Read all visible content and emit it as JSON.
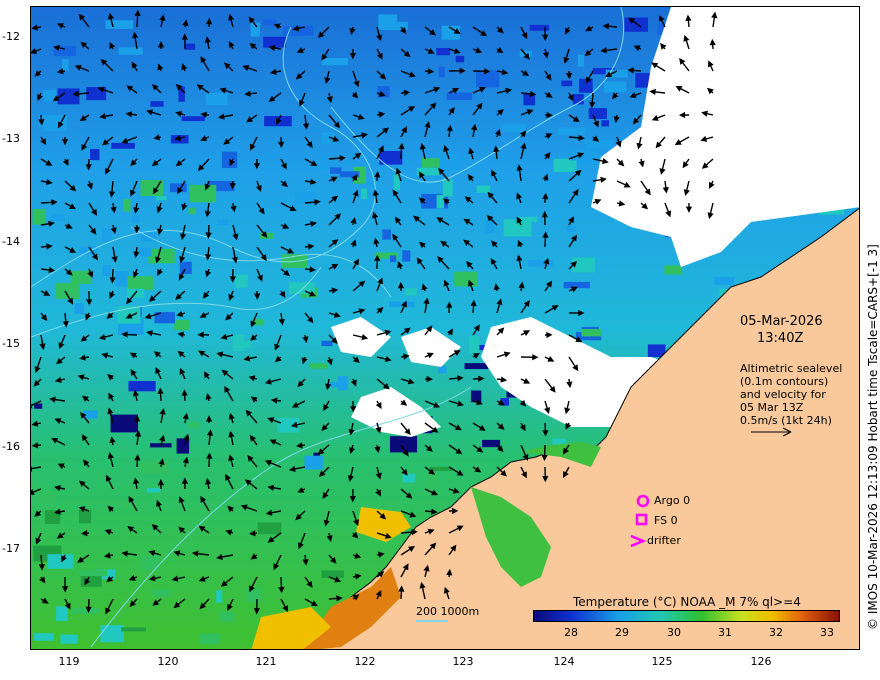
{
  "map": {
    "y_axis_labels": [
      "-12",
      "-13",
      "-14",
      "-15",
      "-16",
      "-17"
    ],
    "x_axis_labels": [
      "119",
      "120",
      "121",
      "122",
      "123",
      "124",
      "125",
      "126"
    ]
  },
  "annotations": {
    "date": "05-Mar-2026",
    "time": "13:40Z",
    "altimetry_lines": [
      "Altimetric sealevel",
      "(0.1m contours)",
      "and velocity for",
      "05 Mar 13Z",
      "0.5m/s (1kt 24h)"
    ]
  },
  "legend": {
    "argo": "Argo 0",
    "fs": "FS 0",
    "drifter": "drifter"
  },
  "colorbar": {
    "title": "Temperature (°C) NOAA _M 7% ql>=4",
    "ticks": [
      "28",
      "29",
      "30",
      "31",
      "32",
      "33"
    ]
  },
  "contour_key": "200  1000m",
  "credit": "© IMOS 10-Mar-2026 12:13:09 Hobart time Tscale=CARS+[-1 3]",
  "colors": {
    "land": "#f9c89b",
    "accent_magenta": "#ff00ff",
    "contour": "#7fd8e8"
  },
  "icons": [
    "argo-circle-icon",
    "fs-square-icon",
    "drifter-arrow-icon",
    "velocity-scale-arrow-icon"
  ]
}
